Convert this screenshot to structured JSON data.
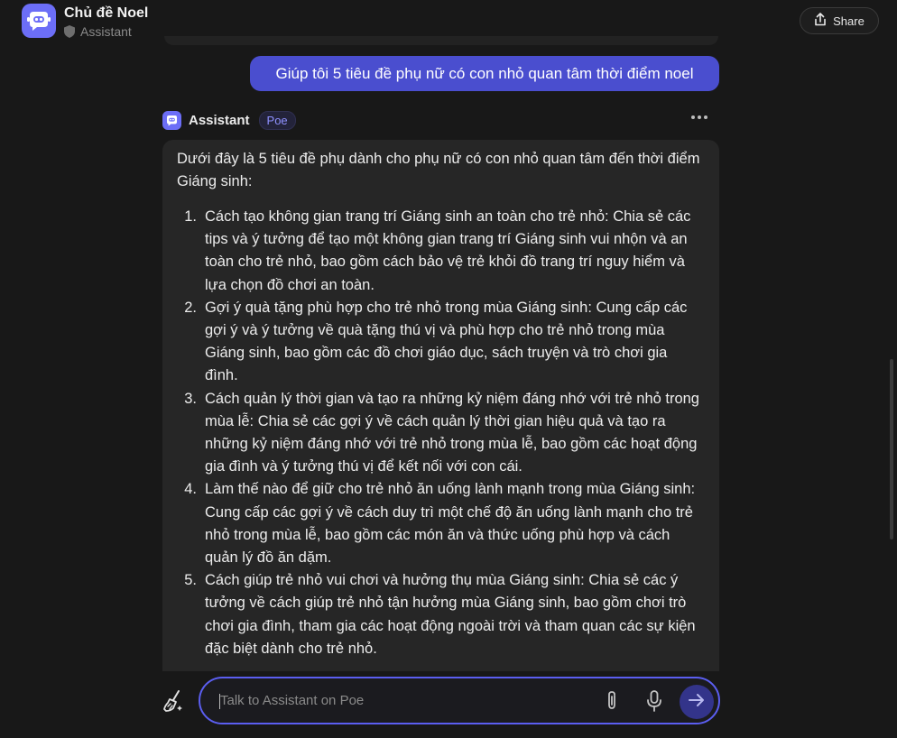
{
  "header": {
    "title": "Chủ đề Noel",
    "subtitle": "Assistant",
    "share_label": "Share"
  },
  "user_message": "Giúp tôi 5 tiêu đề phụ nữ có con nhỏ quan tâm thời điểm noel",
  "bot_message": {
    "name": "Assistant",
    "badge": "Poe",
    "intro": "Dưới đây là 5 tiêu đề phụ dành cho phụ nữ có con nhỏ quan tâm đến thời điểm Giáng sinh:",
    "items": [
      {
        "num": "1.",
        "text": "Cách tạo không gian trang trí Giáng sinh an toàn cho trẻ nhỏ: Chia sẻ các tips và ý tưởng để tạo một không gian trang trí Giáng sinh vui nhộn và an toàn cho trẻ nhỏ, bao gồm cách bảo vệ trẻ khỏi đồ trang trí nguy hiểm và lựa chọn đồ chơi an toàn."
      },
      {
        "num": "2.",
        "text": "Gợi ý quà tặng phù hợp cho trẻ nhỏ trong mùa Giáng sinh: Cung cấp các gợi ý và ý tưởng về quà tặng thú vị và phù hợp cho trẻ nhỏ trong mùa Giáng sinh, bao gồm các đồ chơi giáo dục, sách truyện và trò chơi gia đình."
      },
      {
        "num": "3.",
        "text": "Cách quản lý thời gian và tạo ra những kỷ niệm đáng nhớ với trẻ nhỏ trong mùa lễ: Chia sẻ các gợi ý về cách quản lý thời gian hiệu quả và tạo ra những kỷ niệm đáng nhớ với trẻ nhỏ trong mùa lễ, bao gồm các hoạt động gia đình và ý tưởng thú vị để kết nối với con cái."
      },
      {
        "num": "4.",
        "text": "Làm thế nào để giữ cho trẻ nhỏ ăn uống lành mạnh trong mùa Giáng sinh: Cung cấp các gợi ý về cách duy trì một chế độ ăn uống lành mạnh cho trẻ nhỏ trong mùa lễ, bao gồm các món ăn và thức uống phù hợp và cách quản lý đồ ăn dặm."
      },
      {
        "num": "5.",
        "text": "Cách giúp trẻ nhỏ vui chơi và hưởng thụ mùa Giáng sinh: Chia sẻ các ý tưởng về cách giúp trẻ nhỏ tận hưởng mùa Giáng sinh, bao gồm chơi trò chơi gia đình, tham gia các hoạt động ngoài trời và tham quan các sự kiện đặc biệt dành cho trẻ nhỏ."
      }
    ]
  },
  "composer": {
    "placeholder": "Talk to Assistant on Poe"
  },
  "colors": {
    "accent": "#5b5ef0",
    "user_bubble": "#4a4ecf",
    "background": "#181818",
    "bot_bubble": "#262626"
  },
  "icons": [
    "bot-avatar",
    "shield-icon",
    "share-icon",
    "more-icon",
    "broom-icon",
    "attach-icon",
    "mic-icon",
    "send-arrow-icon"
  ]
}
